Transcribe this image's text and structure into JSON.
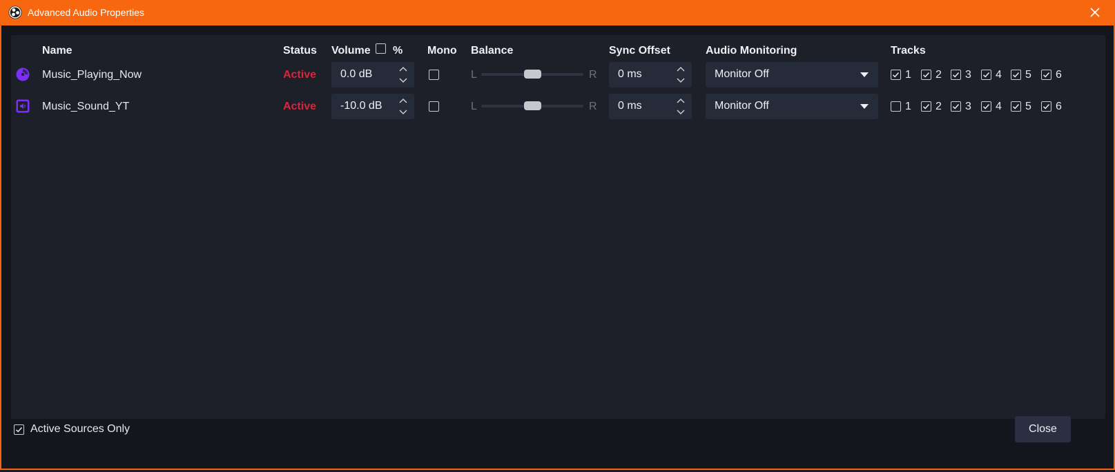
{
  "window": {
    "title": "Advanced Audio Properties"
  },
  "columns": {
    "name": "Name",
    "status": "Status",
    "volume": "Volume",
    "volume_pct": "%",
    "mono": "Mono",
    "balance": "Balance",
    "sync_offset": "Sync Offset",
    "audio_monitoring": "Audio Monitoring",
    "tracks": "Tracks"
  },
  "rows": [
    {
      "name": "Music_Playing_Now",
      "icon": "media-source-icon",
      "status": "Active",
      "volume": "0.0 dB",
      "mono": false,
      "balance_left": "L",
      "balance_right": "R",
      "balance_value": 0.5,
      "sync_offset": "0 ms",
      "monitoring": "Monitor Off",
      "tracks": [
        {
          "label": "1",
          "checked": true
        },
        {
          "label": "2",
          "checked": true
        },
        {
          "label": "3",
          "checked": true
        },
        {
          "label": "4",
          "checked": true
        },
        {
          "label": "5",
          "checked": true
        },
        {
          "label": "6",
          "checked": true
        }
      ]
    },
    {
      "name": "Music_Sound_YT",
      "icon": "audio-output-icon",
      "status": "Active",
      "volume": "-10.0 dB",
      "mono": false,
      "balance_left": "L",
      "balance_right": "R",
      "balance_value": 0.5,
      "sync_offset": "0 ms",
      "monitoring": "Monitor Off",
      "tracks": [
        {
          "label": "1",
          "checked": false
        },
        {
          "label": "2",
          "checked": true
        },
        {
          "label": "3",
          "checked": true
        },
        {
          "label": "4",
          "checked": true
        },
        {
          "label": "5",
          "checked": true
        },
        {
          "label": "6",
          "checked": true
        }
      ]
    }
  ],
  "footer": {
    "active_sources_only": "Active Sources Only",
    "active_sources_only_checked": true,
    "close_label": "Close"
  },
  "colors": {
    "accent": "#f7670f",
    "status_active": "#d7263d",
    "source_icon": "#7b2ff7"
  }
}
